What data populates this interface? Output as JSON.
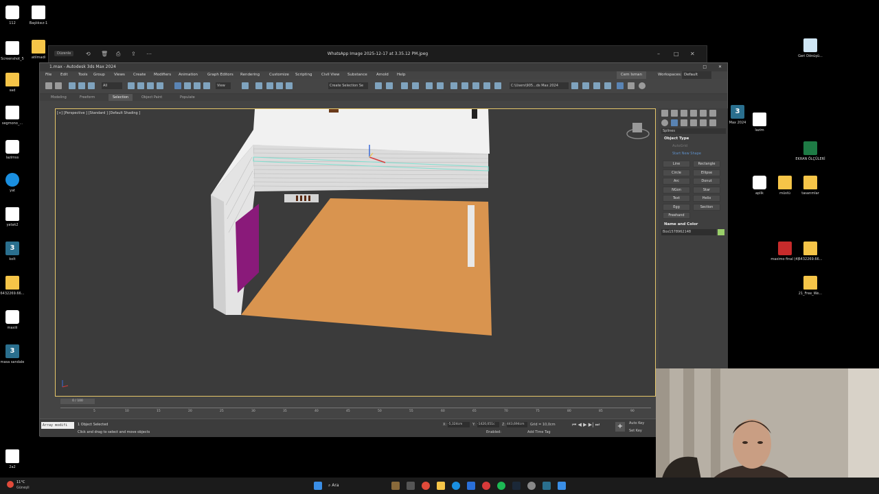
{
  "desktop_icons_left": [
    {
      "label": "112",
      "kind": "app"
    },
    {
      "label": "Screenshot_5",
      "kind": "file"
    },
    {
      "label": "sad",
      "kind": "folder"
    },
    {
      "label": "segmono_...",
      "kind": "file"
    },
    {
      "label": "lazimss",
      "kind": "app"
    },
    {
      "label": "yat",
      "kind": "blue"
    },
    {
      "label": "yatak2",
      "kind": "file"
    },
    {
      "label": "kolt",
      "kind": "max"
    },
    {
      "label": "6432269.66...",
      "kind": "folder"
    },
    {
      "label": "maxiii",
      "kind": "app"
    },
    {
      "label": "masa sandale",
      "kind": "max"
    },
    {
      "label": "2a2",
      "kind": "file"
    }
  ],
  "desktop_icons_col2": [
    {
      "label": "Başlıksız-1",
      "kind": "file"
    },
    {
      "label": "atilmadi",
      "kind": "folder"
    }
  ],
  "desktop_icons_right": [
    {
      "label": "Geri Dönüşü...",
      "kind": "recycle"
    },
    {
      "label": "EKRAN ÖLÇÜLERİ",
      "kind": "excel"
    },
    {
      "label": "aplik",
      "kind": "app"
    },
    {
      "label": "müstü",
      "kind": "folder"
    },
    {
      "label": "tasarımlar",
      "kind": "folder"
    },
    {
      "label": "maximo final (4)",
      "kind": "pdf"
    },
    {
      "label": "6432269.66...",
      "kind": "folder"
    },
    {
      "label": "21_Free_We...",
      "kind": "folder"
    },
    {
      "label": "Max 2024",
      "kind": "max"
    },
    {
      "label": "lazim",
      "kind": "file"
    }
  ],
  "photo_window": {
    "title": "WhatsApp Image 2025-12-17 at 3.35.12 PM.jpeg",
    "edit_label": "Düzenle"
  },
  "max_window": {
    "title": "1.max - Autodesk 3ds Max 2024",
    "menu": [
      "File",
      "Edit",
      "Tools",
      "Group",
      "Views",
      "Create",
      "Modifiers",
      "Animation",
      "Graph Editors",
      "Rendering",
      "Customize",
      "Scripting",
      "Civil View",
      "Substance",
      "Arnold",
      "Help"
    ],
    "user": "Cem Isman",
    "workspace_label": "Workspaces:",
    "workspace_value": "Default",
    "filter_value": "All",
    "view_value": "View",
    "selection_set": "Create Selection Se",
    "path": "C:\\Users\\905...ds Max 2024",
    "ribbon_tabs": [
      "Modeling",
      "Freeform",
      "Selection",
      "Object Paint",
      "Populate"
    ],
    "viewport_label": "[+] [Perspective ] [Standard ] [Default Shading ]",
    "command_panel": {
      "section_object_type": "Object Type",
      "autogrid": "AutoGrid",
      "start_new_shape": "Start New Shape",
      "category": "Splines",
      "buttons": [
        "Line",
        "Rectangle",
        "Circle",
        "Ellipse",
        "Arc",
        "Donut",
        "NGon",
        "Star",
        "Text",
        "Helix",
        "Egg",
        "Section",
        "Freehand"
      ],
      "section_name_color": "Name and Color",
      "object_name": "Box1578962148",
      "object_color": "#9ad06a"
    },
    "timeline": {
      "frame_counter": "0 / 100",
      "ticks": [
        "5",
        "10",
        "15",
        "20",
        "25",
        "30",
        "35",
        "40",
        "45",
        "50",
        "55",
        "60",
        "65",
        "70",
        "75",
        "80",
        "85",
        "90"
      ]
    },
    "status": {
      "script_field": "Array modifi",
      "selected": "1 Object Selected",
      "hint": "Click and drag to select and move objects",
      "x_value": "-5,324cm",
      "y_value": "-1420,051c",
      "z_value": "443,694cm",
      "grid": "Grid = 10,0cm",
      "enabled": "Enabled:",
      "add_time_tag": "Add Time Tag",
      "auto_key": "Auto Key",
      "set_key": "Set Key",
      "selected_label": "Selected"
    }
  },
  "taskbar": {
    "weather_temp": "11°C",
    "weather_desc": "Güneşli",
    "search": "Ara"
  },
  "colors": {
    "floor": "#d9944f",
    "wall": "#e7e7e7",
    "accent_panel": "#8a1a7a",
    "selection": "#e8c86a"
  }
}
